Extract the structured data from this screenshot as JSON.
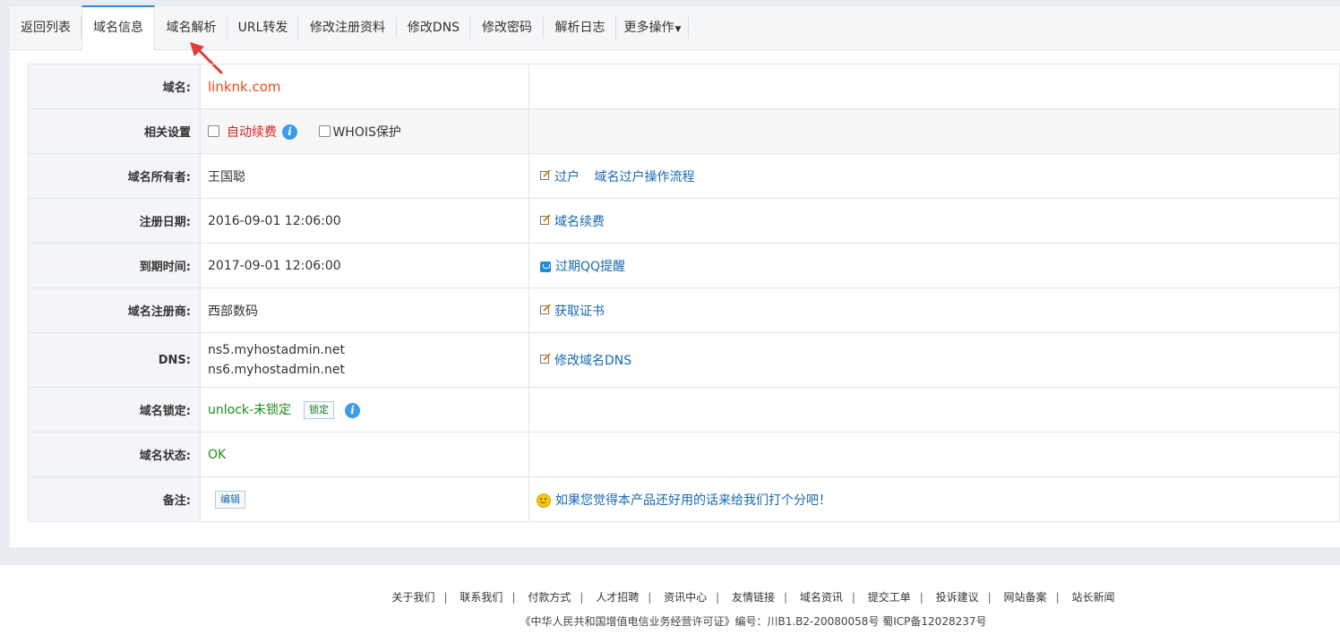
{
  "tabs": [
    {
      "label": "返回列表"
    },
    {
      "label": "域名信息"
    },
    {
      "label": "域名解析"
    },
    {
      "label": "URL转发"
    },
    {
      "label": "修改注册资料"
    },
    {
      "label": "修改DNS"
    },
    {
      "label": "修改密码"
    },
    {
      "label": "解析日志"
    },
    {
      "label": "更多操作"
    }
  ],
  "active_tab": "域名信息",
  "rows": {
    "domain": {
      "label": "域名:",
      "value": "linknk.com"
    },
    "settings": {
      "label": "相关设置",
      "auto_renew": "自动续费",
      "whois": "WHOIS保护"
    },
    "owner": {
      "label": "域名所有者:",
      "value": "王国聪",
      "transfer_link": "过户",
      "transfer_flow_link": "域名过户操作流程"
    },
    "reg_date": {
      "label": "注册日期:",
      "value": "2016-09-01 12:06:00",
      "renew_link": "域名续费"
    },
    "expire_date": {
      "label": "到期时间:",
      "value": "2017-09-01 12:06:00",
      "qq_link": "过期QQ提醒"
    },
    "registrar": {
      "label": "域名注册商:",
      "value": "西部数码",
      "cert_link": "获取证书"
    },
    "dns": {
      "label": "DNS:",
      "ns1": "ns5.myhostadmin.net",
      "ns2": "ns6.myhostadmin.net",
      "modify_link": "修改域名DNS"
    },
    "lock": {
      "label": "域名锁定:",
      "value": "unlock-未锁定",
      "button": "锁定"
    },
    "status": {
      "label": "域名状态:",
      "value": "OK"
    },
    "note": {
      "label": "备注:",
      "button": "编辑",
      "feedback_link": "如果您觉得本产品还好用的话来给我们打个分吧！"
    }
  },
  "footer": {
    "links": [
      "关于我们",
      "联系我们",
      "付款方式",
      "人才招聘",
      "资讯中心",
      "友情链接",
      "域名资讯",
      "提交工单",
      "投诉建议",
      "网站备案",
      "站长新闻"
    ],
    "license": "《中华人民共和国增值电信业务经营许可证》编号：川B1.B2-20080058号  蜀ICP备12028237号"
  },
  "colors": {
    "accent": "#2e8bd6",
    "link": "#1769b3",
    "domain": "#e64a19",
    "ok": "#1f8a1f",
    "warn": "#e01e1e"
  }
}
